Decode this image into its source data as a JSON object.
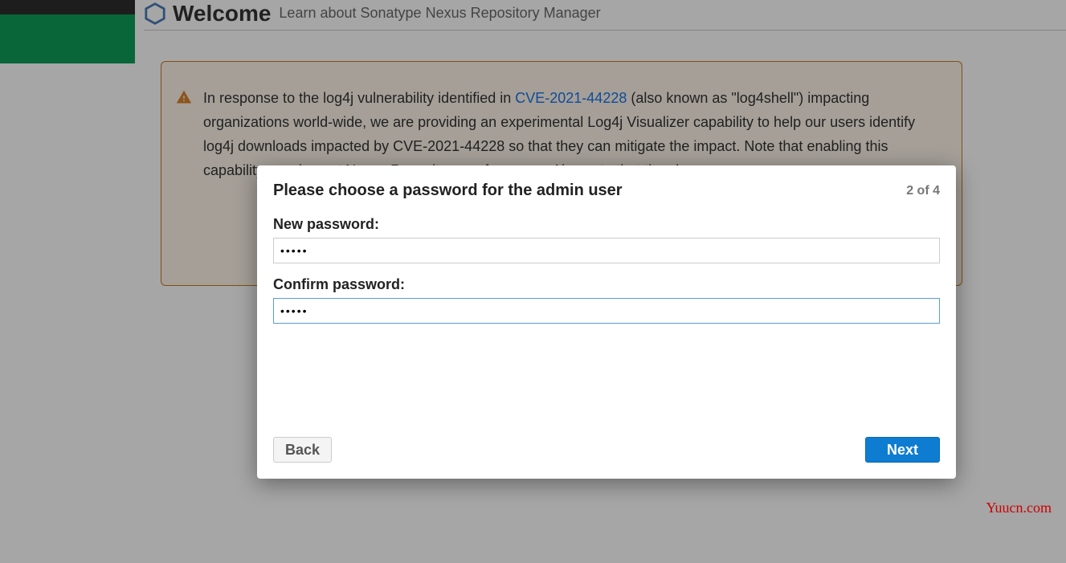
{
  "header": {
    "title": "Welcome",
    "subtitle": "Learn about Sonatype Nexus Repository Manager"
  },
  "notice": {
    "text_before_link": "In response to the log4j vulnerability identified in ",
    "link_text": "CVE-2021-44228",
    "text_after_link": " (also known as \"log4shell\") impacting organizations world-wide, we are providing an experimental Log4j Visualizer capability to help our users identify log4j downloads impacted by CVE-2021-44228 so that they can mitigate the impact. Note that enabling this capability may impact Nexus Repository performance. Also note that the visu"
  },
  "modal": {
    "title": "Please choose a password for the admin user",
    "step_indicator": "2 of 4",
    "new_password_label": "New password:",
    "new_password_value": "•••••",
    "confirm_password_label": "Confirm password:",
    "confirm_password_value": "•••••",
    "back_label": "Back",
    "next_label": "Next"
  },
  "watermark": "Yuucn.com"
}
